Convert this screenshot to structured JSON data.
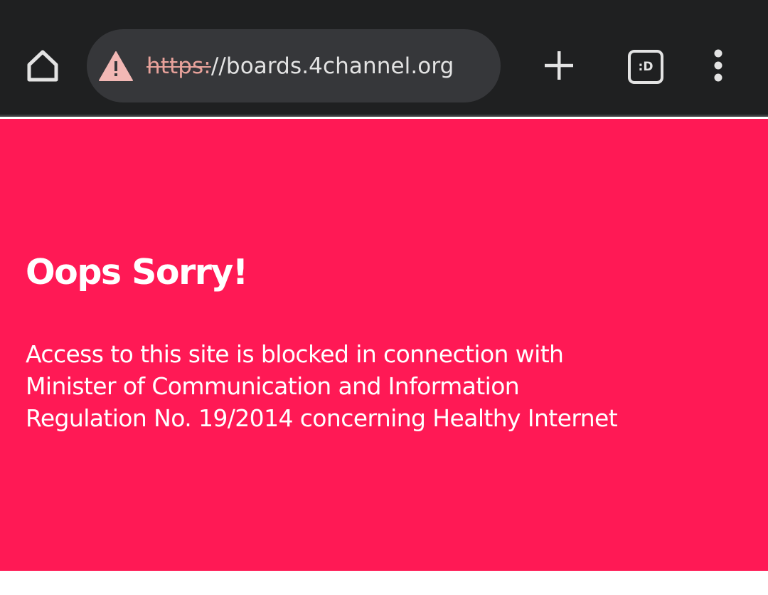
{
  "browser": {
    "url_scheme": "https:",
    "url_rest": "//boards.4channel.org",
    "tab_count": ":D",
    "icons": {
      "home": "home-icon",
      "warning": "warning-triangle-icon",
      "new_tab": "plus-icon",
      "tabs": "tab-switcher-icon",
      "menu": "more-vert-icon"
    },
    "colors": {
      "toolbar": "#1f2021",
      "omnibox": "#36373a",
      "warning": "#f2b8b5",
      "scheme_strikethrough": "#e8a29b"
    }
  },
  "page": {
    "heading": "Oops Sorry!",
    "message_lines": [
      "Access to this site is blocked in connection with",
      "Minister of Communication and Information",
      "Regulation No. 19/2014 concerning Healthy Internet"
    ],
    "background_color": "#ff1955"
  }
}
